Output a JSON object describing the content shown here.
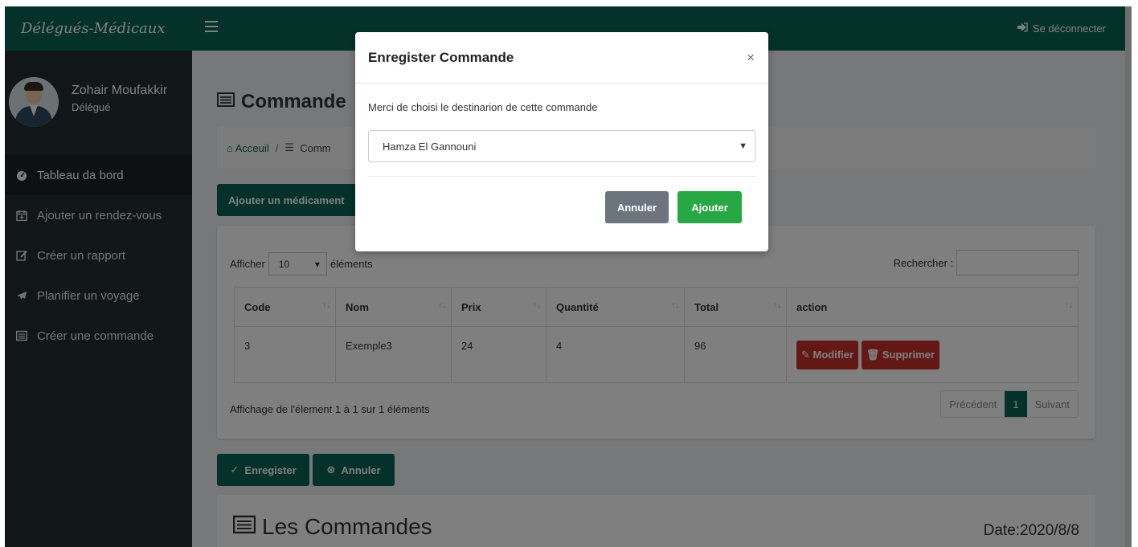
{
  "sidebar": {
    "brand": "Délégués-Médicaux",
    "user_name": "Zohair Moufakkir",
    "user_role": "Délégué",
    "items": [
      {
        "label": "Tableau da bord",
        "icon": "dashboard-icon"
      },
      {
        "label": "Ajouter un rendez-vous",
        "icon": "calendar-plus-icon"
      },
      {
        "label": "Créer un rapport",
        "icon": "edit-icon"
      },
      {
        "label": "Planifier un voyage",
        "icon": "plane-icon"
      },
      {
        "label": "Créer une commande",
        "icon": "list-icon"
      }
    ],
    "active_index": 0
  },
  "topbar": {
    "logout_label": "Se déconnecter"
  },
  "page": {
    "title": "Commande",
    "breadcrumb_home": "Acceuil",
    "breadcrumb_sep": "/",
    "breadcrumb_current": "Comm",
    "add_button": "Ajouter un médicament",
    "length_label_before": "Afficher",
    "length_value": "10",
    "length_label_after": "éléments",
    "search_label": "Rechercher :",
    "table": {
      "columns": [
        "Code",
        "Nom",
        "Prix",
        "Quantité",
        "Total",
        "action"
      ],
      "rows": [
        {
          "code": "3",
          "nom": "Exemple3",
          "prix": "24",
          "quantite": "4",
          "total": "96"
        }
      ],
      "edit_label": "Modifier",
      "delete_label": "Supprimer"
    },
    "info": "Affichage de l'élement 1 à 1 sur 1 éléments",
    "pager": {
      "prev": "Précédent",
      "current": "1",
      "next": "Suivant"
    },
    "save_button": "Enregister",
    "cancel_button": "Annuler",
    "orders_title": "Les Commandes",
    "orders_date": "Date:2020/8/8"
  },
  "modal": {
    "title": "Enregister Commande",
    "close": "×",
    "message": "Merci de choisi le destinarion de cette commande",
    "select_value": "Hamza El Gannouni",
    "cancel_label": "Annuler",
    "confirm_label": "Ajouter"
  },
  "colors": {
    "brand": "#096457",
    "sidebar": "#222d32",
    "danger": "#c9302c",
    "success": "#28a745",
    "secondary": "#6c757d"
  }
}
